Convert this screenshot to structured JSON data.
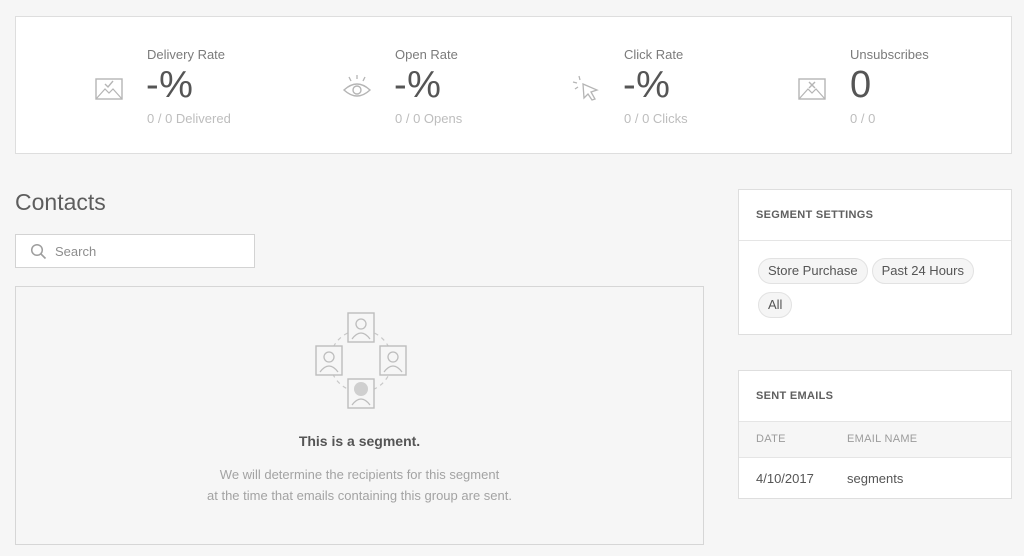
{
  "stats": [
    {
      "icon": "delivered-envelope-icon",
      "label": "Delivery Rate",
      "value": "-%",
      "sub": "0 / 0 Delivered"
    },
    {
      "icon": "eye-icon",
      "label": "Open Rate",
      "value": "-%",
      "sub": "0 / 0 Opens"
    },
    {
      "icon": "cursor-click-icon",
      "label": "Click Rate",
      "value": "-%",
      "sub": "0 / 0 Clicks"
    },
    {
      "icon": "unsubscribe-envelope-icon",
      "label": "Unsubscribes",
      "value": "0",
      "sub": "0 / 0"
    }
  ],
  "contacts": {
    "title": "Contacts",
    "search_placeholder": "Search",
    "empty_title": "This is a segment.",
    "empty_line1": "We will determine the recipients for this segment",
    "empty_line2": "at the time that emails containing this group are sent."
  },
  "segment_settings": {
    "heading": "SEGMENT SETTINGS",
    "tags": [
      "Store Purchase",
      "Past 24 Hours",
      "All"
    ]
  },
  "sent_emails": {
    "heading": "SENT EMAILS",
    "columns": [
      "DATE",
      "EMAIL NAME"
    ],
    "rows": [
      {
        "date": "4/10/2017",
        "name": "segments"
      }
    ]
  }
}
